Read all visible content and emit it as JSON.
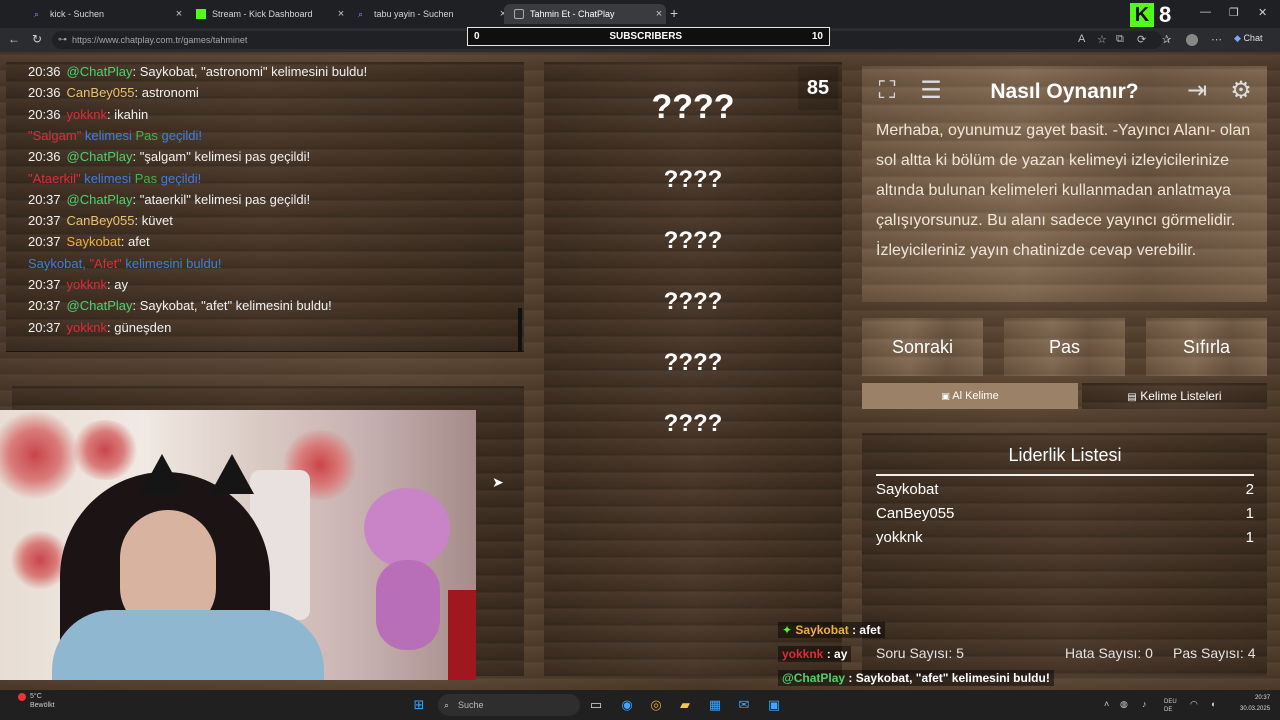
{
  "browser": {
    "tabs": [
      {
        "label": "kick - Suchen"
      },
      {
        "label": "Stream - Kick Dashboard"
      },
      {
        "label": "tabu yayin - Suchen"
      },
      {
        "label": "Tahmin Et - ChatPlay"
      }
    ],
    "url": "https://www.chatplay.com.tr/games/tahminet",
    "brand_number": "8",
    "chat_button": "Chat"
  },
  "subscribers": {
    "left": "0",
    "label": "SUBSCRIBERS",
    "right": "10"
  },
  "chat_log": [
    {
      "time": "20:36",
      "user": "@ChatPlay",
      "user_color": "chatplay",
      "sep": ": ",
      "text": "Saykobat, \"astronomi\" kelimesini buldu!"
    },
    {
      "time": "20:36",
      "user": "CanBey055",
      "user_color": "canbey",
      "sep": ": ",
      "text": "astronomi"
    },
    {
      "time": "20:36",
      "user": "yokknk",
      "user_color": "yokknk",
      "sep": ": ",
      "text": "ikahin"
    },
    {
      "system": true,
      "parts": [
        {
          "t": "\"Salgam\"",
          "c": "red"
        },
        {
          "t": " kelimesi ",
          "c": "blue"
        },
        {
          "t": "Pas",
          "c": "green"
        },
        {
          "t": " geçildi!",
          "c": "blue"
        }
      ]
    },
    {
      "time": "20:36",
      "user": "@ChatPlay",
      "user_color": "chatplay",
      "sep": ": ",
      "text": "\"şalgam\" kelimesi pas geçildi!"
    },
    {
      "system": true,
      "parts": [
        {
          "t": "\"Ataerkil\"",
          "c": "red"
        },
        {
          "t": " kelimesi ",
          "c": "blue"
        },
        {
          "t": "Pas",
          "c": "green"
        },
        {
          "t": " geçildi!",
          "c": "blue"
        }
      ]
    },
    {
      "time": "20:37",
      "user": "@ChatPlay",
      "user_color": "chatplay",
      "sep": ": ",
      "text": "\"ataerkil\" kelimesi pas geçildi!"
    },
    {
      "time": "20:37",
      "user": "CanBey055",
      "user_color": "canbey",
      "sep": ": ",
      "text": "küvet"
    },
    {
      "time": "20:37",
      "user": "Saykobat",
      "user_color": "saykobat",
      "sep": ": ",
      "text": "afet"
    },
    {
      "system": true,
      "parts": [
        {
          "t": "Saykobat, ",
          "c": "blue"
        },
        {
          "t": "\"Afet\"",
          "c": "red"
        },
        {
          "t": " kelimesini buldu!",
          "c": "blue"
        }
      ]
    },
    {
      "time": "20:37",
      "user": "yokknk",
      "user_color": "yokknk",
      "sep": ": ",
      "text": "ay"
    },
    {
      "time": "20:37",
      "user": "@ChatPlay",
      "user_color": "chatplay",
      "sep": ": ",
      "text": "Saykobat, \"afet\" kelimesini buldu!"
    },
    {
      "time": "20:37",
      "user": "yokknk",
      "user_color": "yokknk",
      "sep": ": ",
      "text": "güneşden"
    }
  ],
  "words": {
    "main": "????",
    "list": [
      "????",
      "????",
      "????",
      "????",
      "????"
    ]
  },
  "counter": "85",
  "help": {
    "title": "Nasıl Oynanır?",
    "body": "Merhaba, oyunumuz gayet basit. -Yayıncı Alanı- olan sol altta ki bölüm de yazan kelimeyi izleyicilerinize altında bulunan kelimeleri kullanmadan anlatmaya çalışıyorsunuz. Bu alanı sadece yayıncı görmelidir. İzleyicileriniz yayın chatinizde cevap verebilir."
  },
  "controls": {
    "next": "Sonraki",
    "pass": "Pas",
    "reset": "Sıfırla"
  },
  "word_tabs": {
    "get_word": "Al Kelime",
    "word_lists": "Kelime Listeleri"
  },
  "leaderboard": {
    "title": "Liderlik Listesi",
    "rows": [
      {
        "name": "Saykobat",
        "score": "2"
      },
      {
        "name": "CanBey055",
        "score": "1"
      },
      {
        "name": "yokknk",
        "score": "1"
      }
    ]
  },
  "stats": {
    "questions": "Soru Sayısı: 5",
    "errors": "Hata Sayısı: 0",
    "passes": "Pas Sayısı: 4"
  },
  "overlay_chat": [
    {
      "user": "Saykobat",
      "user_color": "#f0b040",
      "text": " : afet"
    },
    {
      "user": "yokknk",
      "user_color": "#e02a3a",
      "text": " : ay"
    },
    {
      "user": "@ChatPlay",
      "user_color": "#4fd06b",
      "text": " : Saykobat, \"afet\" kelimesini buldu!"
    },
    {
      "user": "yokknk",
      "user_color": "#e02a3a",
      "text": " güneşden"
    }
  ],
  "taskbar": {
    "weather_temp": "5°C",
    "weather_desc": "Bewölkt",
    "search": "Suche",
    "lang1": "DEU",
    "lang2": "DE",
    "time": "20:37",
    "date": "30.03.2025"
  },
  "colors": {
    "accent_green": "#53fc18",
    "chatplay_green": "#4fd06b",
    "red": "#e02a3a",
    "blue": "#3f7de0"
  }
}
